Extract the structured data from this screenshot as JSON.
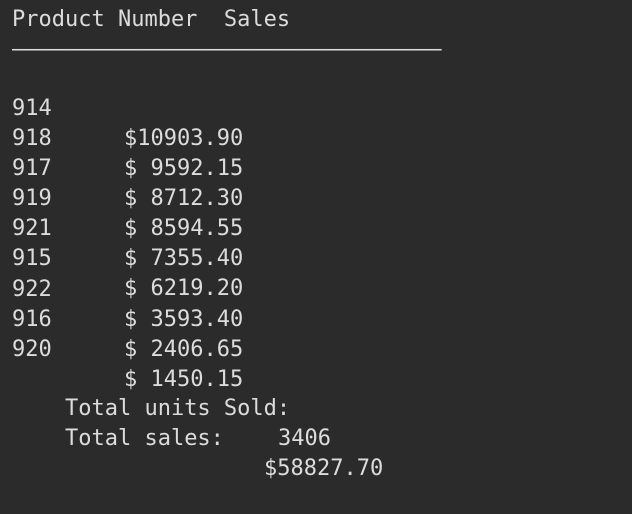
{
  "window": {
    "top_cut_text": "                                 ..   .., .. ."
  },
  "table": {
    "header": "Product Number  Sales",
    "divider": "———————————————————————————————————",
    "rows": [
      {
        "product": "914",
        "sales": "$10903.90"
      },
      {
        "product": "918",
        "sales": "$ 9592.15"
      },
      {
        "product": "917",
        "sales": "$ 8712.30"
      },
      {
        "product": "919",
        "sales": "$ 8594.55"
      },
      {
        "product": "921",
        "sales": "$ 7355.40"
      },
      {
        "product": "915",
        "sales": "$ 6219.20"
      },
      {
        "product": "922",
        "sales": "$ 3593.40"
      },
      {
        "product": "916",
        "sales": "$ 2406.65"
      },
      {
        "product": "920",
        "sales": "$ 1450.15"
      }
    ]
  },
  "summary": {
    "units_label": "Total units Sold:",
    "units_value": "3406",
    "sales_label": "Total sales:",
    "sales_value": "$58827.70"
  }
}
